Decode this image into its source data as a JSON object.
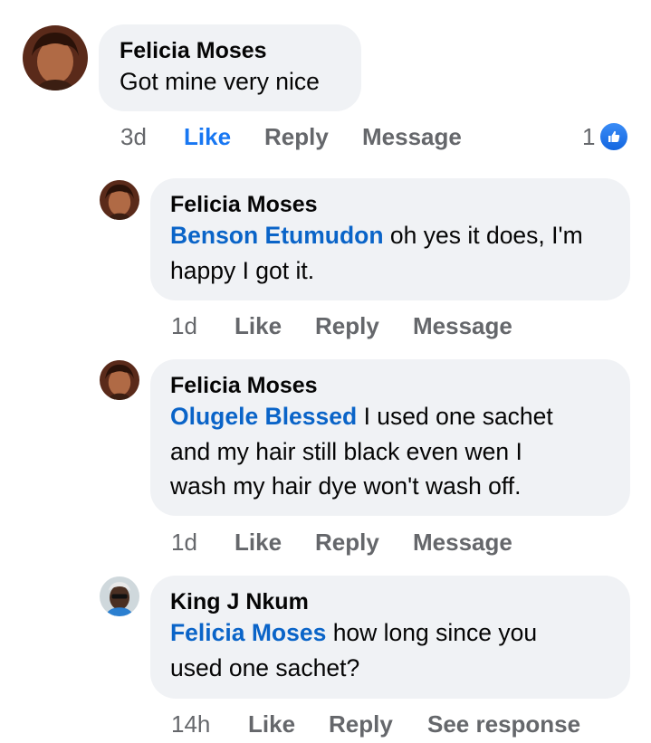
{
  "comments": [
    {
      "author": "Felicia Moses",
      "text": "Got mine very nice",
      "time": "3d",
      "actions": {
        "like": "Like",
        "reply": "Reply",
        "message": "Message"
      },
      "reaction_count": "1",
      "liked": true
    },
    {
      "author": "Felicia Moses",
      "mention": "Benson Etumudon",
      "text_line1": " oh yes it does, I'm",
      "text_line2": "happy I got it.",
      "time": "1d",
      "actions": {
        "like": "Like",
        "reply": "Reply",
        "message": "Message"
      }
    },
    {
      "author": "Felicia Moses",
      "mention": "Olugele Blessed",
      "text_line1": " I used one sachet",
      "text_line2": "and my hair still black even wen I",
      "text_line3": "wash my hair dye won't wash off.",
      "time": "1d",
      "actions": {
        "like": "Like",
        "reply": "Reply",
        "message": "Message"
      }
    },
    {
      "author": "King J Nkum",
      "mention": "Felicia Moses",
      "text_line1": " how long since you",
      "text_line2": "used one sachet?",
      "time": "14h",
      "actions": {
        "like": "Like",
        "reply": "Reply",
        "see_response": "See response"
      }
    }
  ],
  "colors": {
    "bubble": "#f0f2f5",
    "mention": "#0a64c8",
    "meta": "#65676b",
    "like_active": "#1877f2"
  },
  "icons": {
    "reaction": "like-thumb-icon",
    "avatar_felicia": "avatar-photo",
    "avatar_king": "avatar-photo"
  }
}
